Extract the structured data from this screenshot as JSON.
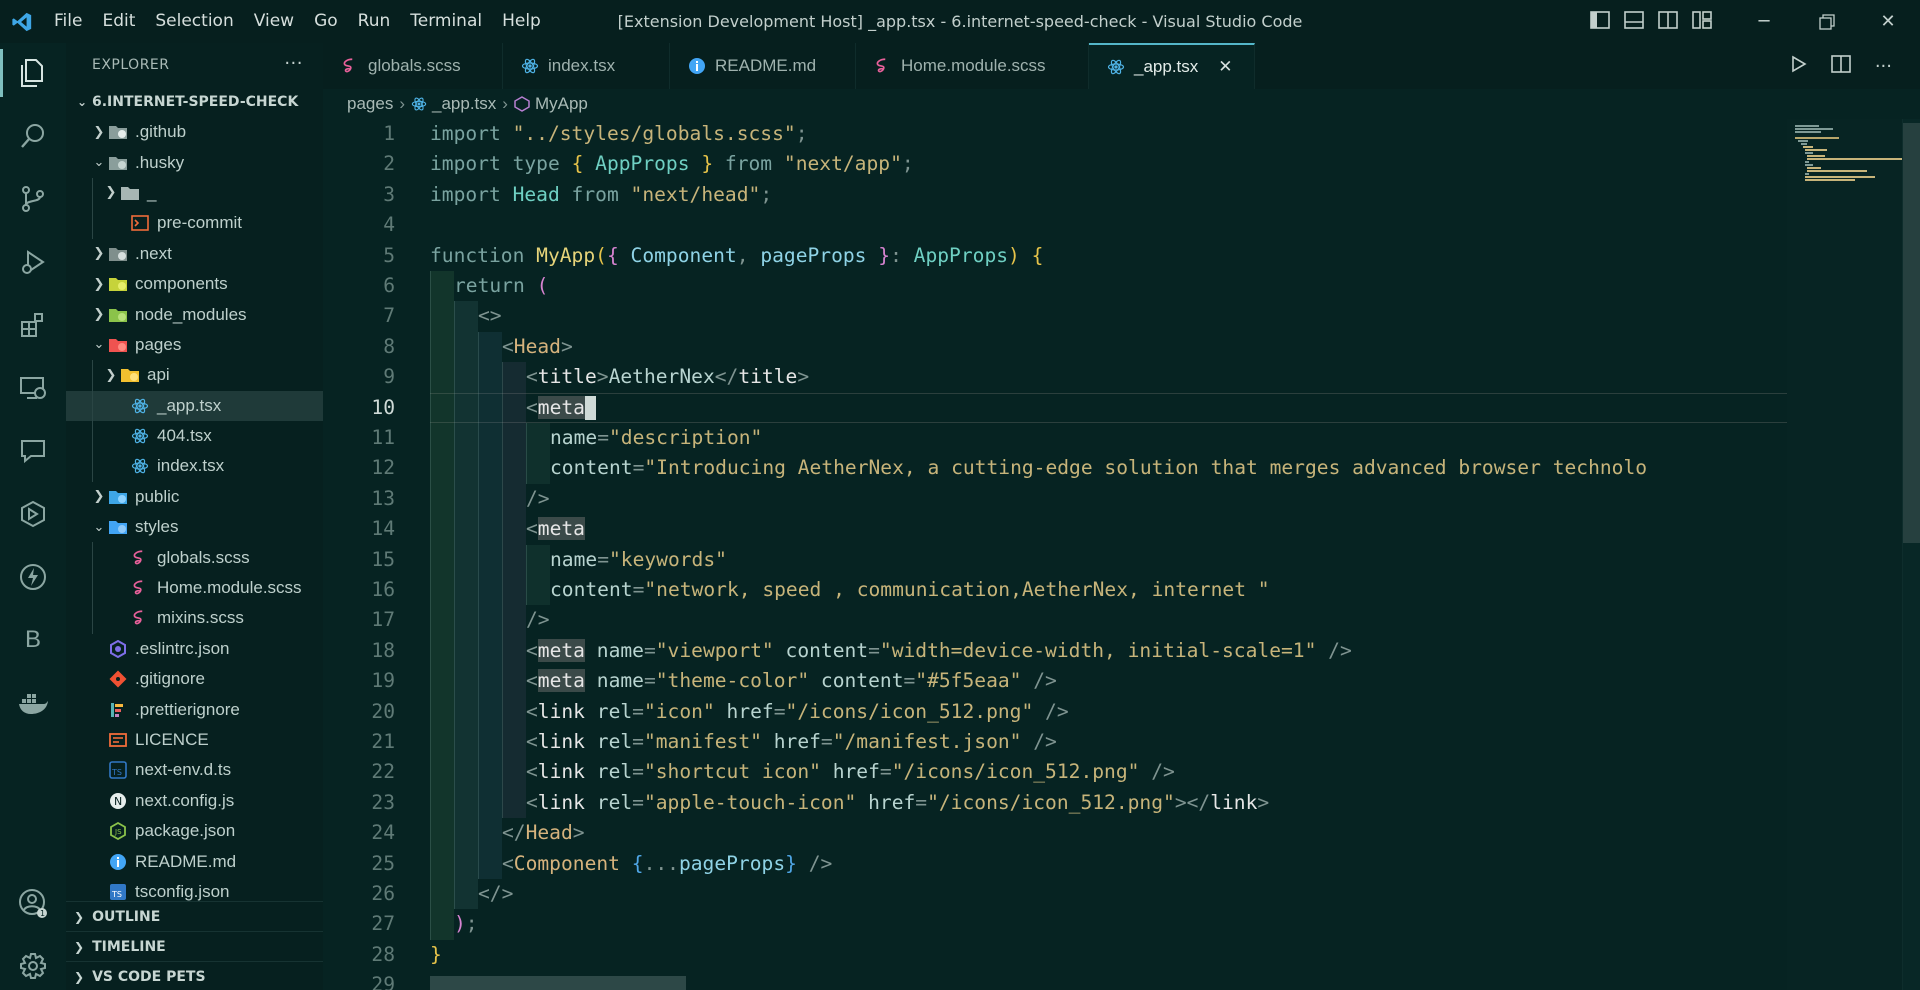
{
  "window": {
    "title": "[Extension Development Host] _app.tsx - 6.internet-speed-check - Visual Studio Code",
    "menu": [
      "File",
      "Edit",
      "Selection",
      "View",
      "Go",
      "Run",
      "Terminal",
      "Help"
    ],
    "accent": "#54b6c9"
  },
  "sidebar": {
    "header": "EXPLORER",
    "more": "···",
    "root": "6.INTERNET-SPEED-CHECK",
    "items": [
      {
        "label": ".github",
        "icon": "github-folder-icon",
        "depth": 1,
        "chev": "right"
      },
      {
        "label": ".husky",
        "icon": "husky-folder-icon",
        "depth": 1,
        "chev": "down"
      },
      {
        "label": "_",
        "icon": "folder-icon",
        "depth": 2,
        "chev": "right"
      },
      {
        "label": "pre-commit",
        "icon": "shell-file-icon",
        "depth": 2,
        "chev": ""
      },
      {
        "label": ".next",
        "icon": "next-folder-icon",
        "depth": 1,
        "chev": "right"
      },
      {
        "label": "components",
        "icon": "components-folder-icon",
        "depth": 1,
        "chev": "right"
      },
      {
        "label": "node_modules",
        "icon": "node-folder-icon",
        "depth": 1,
        "chev": "right"
      },
      {
        "label": "pages",
        "icon": "pages-folder-icon",
        "depth": 1,
        "chev": "down"
      },
      {
        "label": "api",
        "icon": "api-folder-icon",
        "depth": 2,
        "chev": "right"
      },
      {
        "label": "_app.tsx",
        "icon": "react-file-icon",
        "depth": 2,
        "chev": "",
        "selected": true
      },
      {
        "label": "404.tsx",
        "icon": "react-file-icon",
        "depth": 2,
        "chev": ""
      },
      {
        "label": "index.tsx",
        "icon": "react-file-icon",
        "depth": 2,
        "chev": ""
      },
      {
        "label": "public",
        "icon": "public-folder-icon",
        "depth": 1,
        "chev": "right"
      },
      {
        "label": "styles",
        "icon": "styles-folder-icon",
        "depth": 1,
        "chev": "down"
      },
      {
        "label": "globals.scss",
        "icon": "sass-file-icon",
        "depth": 2,
        "chev": ""
      },
      {
        "label": "Home.module.scss",
        "icon": "sass-file-icon",
        "depth": 2,
        "chev": ""
      },
      {
        "label": "mixins.scss",
        "icon": "sass-file-icon",
        "depth": 2,
        "chev": ""
      },
      {
        "label": ".eslintrc.json",
        "icon": "eslint-file-icon",
        "depth": 1,
        "chev": ""
      },
      {
        "label": ".gitignore",
        "icon": "git-file-icon",
        "depth": 1,
        "chev": ""
      },
      {
        "label": ".prettierignore",
        "icon": "prettier-file-icon",
        "depth": 1,
        "chev": ""
      },
      {
        "label": "LICENCE",
        "icon": "license-file-icon",
        "depth": 1,
        "chev": ""
      },
      {
        "label": "next-env.d.ts",
        "icon": "ts-def-file-icon",
        "depth": 1,
        "chev": ""
      },
      {
        "label": "next.config.js",
        "icon": "next-file-icon",
        "depth": 1,
        "chev": ""
      },
      {
        "label": "package.json",
        "icon": "node-file-icon",
        "depth": 1,
        "chev": ""
      },
      {
        "label": "README.md",
        "icon": "info-file-icon",
        "depth": 1,
        "chev": ""
      },
      {
        "label": "tsconfig.json",
        "icon": "ts-config-file-icon",
        "depth": 1,
        "chev": ""
      }
    ],
    "sections": [
      "OUTLINE",
      "TIMELINE",
      "VS CODE PETS"
    ]
  },
  "tabs": [
    {
      "label": "globals.scss",
      "icon": "sass-file-icon"
    },
    {
      "label": "index.tsx",
      "icon": "react-file-icon"
    },
    {
      "label": "README.md",
      "icon": "info-file-icon"
    },
    {
      "label": "Home.module.scss",
      "icon": "sass-file-icon"
    },
    {
      "label": "_app.tsx",
      "icon": "react-file-icon",
      "active": true
    }
  ],
  "tab_close": "✕",
  "breadcrumb": [
    "pages",
    "_app.tsx",
    "MyApp"
  ],
  "editor": {
    "current_line": 10,
    "lines": [
      {
        "n": "1",
        "indent": 0,
        "tokens": [
          [
            "k",
            "import "
          ],
          [
            "s",
            "\"../styles/globals.scss\""
          ],
          [
            "pn",
            ";"
          ]
        ]
      },
      {
        "n": "2",
        "indent": 0,
        "tokens": [
          [
            "k",
            "import type "
          ],
          [
            "b1",
            "{ "
          ],
          [
            "ty",
            "AppProps"
          ],
          [
            "b1",
            " }"
          ],
          [
            "k",
            " from "
          ],
          [
            "s",
            "\"next/app\""
          ],
          [
            "pn",
            ";"
          ]
        ]
      },
      {
        "n": "3",
        "indent": 0,
        "tokens": [
          [
            "k",
            "import "
          ],
          [
            "ty",
            "Head"
          ],
          [
            "k",
            " from "
          ],
          [
            "s",
            "\"next/head\""
          ],
          [
            "pn",
            ";"
          ]
        ]
      },
      {
        "n": "4",
        "indent": 0,
        "tokens": []
      },
      {
        "n": "5",
        "indent": 0,
        "tokens": [
          [
            "k",
            "function "
          ],
          [
            "f",
            "MyApp"
          ],
          [
            "b1",
            "("
          ],
          [
            "b2",
            "{ "
          ],
          [
            "v",
            "Component"
          ],
          [
            "pn",
            ", "
          ],
          [
            "v",
            "pageProps"
          ],
          [
            "b2",
            " }"
          ],
          [
            "pn",
            ": "
          ],
          [
            "ty",
            "AppProps"
          ],
          [
            "b1",
            ")"
          ],
          [
            "b1",
            " {"
          ]
        ]
      },
      {
        "n": "6",
        "indent": 1,
        "tokens": [
          [
            "k",
            "return "
          ],
          [
            "b2",
            "("
          ]
        ]
      },
      {
        "n": "7",
        "indent": 2,
        "tokens": [
          [
            "pn",
            "<>"
          ]
        ]
      },
      {
        "n": "8",
        "indent": 3,
        "tokens": [
          [
            "pn",
            "<"
          ],
          [
            "hd",
            "Head"
          ],
          [
            "pn",
            ">"
          ]
        ]
      },
      {
        "n": "9",
        "indent": 4,
        "tokens": [
          [
            "pn",
            "<"
          ],
          [
            "tg",
            "title"
          ],
          [
            "pn",
            ">"
          ],
          [
            "at",
            "AetherNex"
          ],
          [
            "pn",
            "</"
          ],
          [
            "tg",
            "title"
          ],
          [
            "pn",
            ">"
          ]
        ]
      },
      {
        "n": "10",
        "indent": 4,
        "tokens": [
          [
            "pn",
            "<"
          ],
          [
            "tgh",
            "meta"
          ]
        ],
        "cursor": true
      },
      {
        "n": "11",
        "indent": 5,
        "tokens": [
          [
            "at",
            "name"
          ],
          [
            "pn",
            "="
          ],
          [
            "s",
            "\"description\""
          ]
        ]
      },
      {
        "n": "12",
        "indent": 5,
        "tokens": [
          [
            "at",
            "content"
          ],
          [
            "pn",
            "="
          ],
          [
            "s",
            "\"Introducing AetherNex, a cutting-edge solution that merges advanced browser technolo"
          ]
        ]
      },
      {
        "n": "13",
        "indent": 4,
        "tokens": [
          [
            "pn",
            "/>"
          ]
        ]
      },
      {
        "n": "14",
        "indent": 4,
        "tokens": [
          [
            "pn",
            "<"
          ],
          [
            "tgh",
            "meta"
          ]
        ]
      },
      {
        "n": "15",
        "indent": 5,
        "tokens": [
          [
            "at",
            "name"
          ],
          [
            "pn",
            "="
          ],
          [
            "s",
            "\"keywords\""
          ]
        ]
      },
      {
        "n": "16",
        "indent": 5,
        "tokens": [
          [
            "at",
            "content"
          ],
          [
            "pn",
            "="
          ],
          [
            "s",
            "\"network, speed , communication,AetherNex, internet \""
          ]
        ]
      },
      {
        "n": "17",
        "indent": 4,
        "tokens": [
          [
            "pn",
            "/>"
          ]
        ]
      },
      {
        "n": "18",
        "indent": 4,
        "tokens": [
          [
            "pn",
            "<"
          ],
          [
            "tgh",
            "meta"
          ],
          [
            "at",
            " name"
          ],
          [
            "pn",
            "="
          ],
          [
            "s",
            "\"viewport\""
          ],
          [
            "at",
            " content"
          ],
          [
            "pn",
            "="
          ],
          [
            "s",
            "\"width=device-width, initial-scale=1\""
          ],
          [
            "pn",
            " />"
          ]
        ]
      },
      {
        "n": "19",
        "indent": 4,
        "tokens": [
          [
            "pn",
            "<"
          ],
          [
            "tgh",
            "meta"
          ],
          [
            "at",
            " name"
          ],
          [
            "pn",
            "="
          ],
          [
            "s",
            "\"theme-color\""
          ],
          [
            "at",
            " content"
          ],
          [
            "pn",
            "="
          ],
          [
            "s",
            "\"#5f5eaa\""
          ],
          [
            "pn",
            " />"
          ]
        ]
      },
      {
        "n": "20",
        "indent": 4,
        "tokens": [
          [
            "pn",
            "<"
          ],
          [
            "tg",
            "link"
          ],
          [
            "at",
            " rel"
          ],
          [
            "pn",
            "="
          ],
          [
            "s",
            "\"icon\""
          ],
          [
            "at",
            " href"
          ],
          [
            "pn",
            "="
          ],
          [
            "s",
            "\"/icons/icon_512.png\""
          ],
          [
            "pn",
            " />"
          ]
        ]
      },
      {
        "n": "21",
        "indent": 4,
        "tokens": [
          [
            "pn",
            "<"
          ],
          [
            "tg",
            "link"
          ],
          [
            "at",
            " rel"
          ],
          [
            "pn",
            "="
          ],
          [
            "s",
            "\"manifest\""
          ],
          [
            "at",
            " href"
          ],
          [
            "pn",
            "="
          ],
          [
            "s",
            "\"/manifest.json\""
          ],
          [
            "pn",
            " />"
          ]
        ]
      },
      {
        "n": "22",
        "indent": 4,
        "tokens": [
          [
            "pn",
            "<"
          ],
          [
            "tg",
            "link"
          ],
          [
            "at",
            " rel"
          ],
          [
            "pn",
            "="
          ],
          [
            "s",
            "\"shortcut icon\""
          ],
          [
            "at",
            " href"
          ],
          [
            "pn",
            "="
          ],
          [
            "s",
            "\"/icons/icon_512.png\""
          ],
          [
            "pn",
            " />"
          ]
        ]
      },
      {
        "n": "23",
        "indent": 4,
        "tokens": [
          [
            "pn",
            "<"
          ],
          [
            "tg",
            "link"
          ],
          [
            "at",
            " rel"
          ],
          [
            "pn",
            "="
          ],
          [
            "s",
            "\"apple-touch-icon\""
          ],
          [
            "at",
            " href"
          ],
          [
            "pn",
            "="
          ],
          [
            "s",
            "\"/icons/icon_512.png\""
          ],
          [
            "pn",
            "></"
          ],
          [
            "tg",
            "link"
          ],
          [
            "pn",
            ">"
          ]
        ]
      },
      {
        "n": "24",
        "indent": 3,
        "tokens": [
          [
            "pn",
            "</"
          ],
          [
            "hd",
            "Head"
          ],
          [
            "pn",
            ">"
          ]
        ]
      },
      {
        "n": "25",
        "indent": 3,
        "tokens": [
          [
            "pn",
            "<"
          ],
          [
            "hd",
            "Component"
          ],
          [
            "b3",
            " {"
          ],
          [
            "pn",
            "..."
          ],
          [
            "v",
            "pageProps"
          ],
          [
            "b3",
            "}"
          ],
          [
            "pn",
            " />"
          ]
        ]
      },
      {
        "n": "26",
        "indent": 2,
        "tokens": [
          [
            "pn",
            "</>"
          ]
        ]
      },
      {
        "n": "27",
        "indent": 1,
        "tokens": [
          [
            "b2",
            ")"
          ],
          [
            "pn",
            ";"
          ]
        ]
      },
      {
        "n": "28",
        "indent": 0,
        "tokens": [
          [
            "b1",
            "}"
          ]
        ]
      },
      {
        "n": "29",
        "indent": 0,
        "tokens": []
      }
    ]
  }
}
